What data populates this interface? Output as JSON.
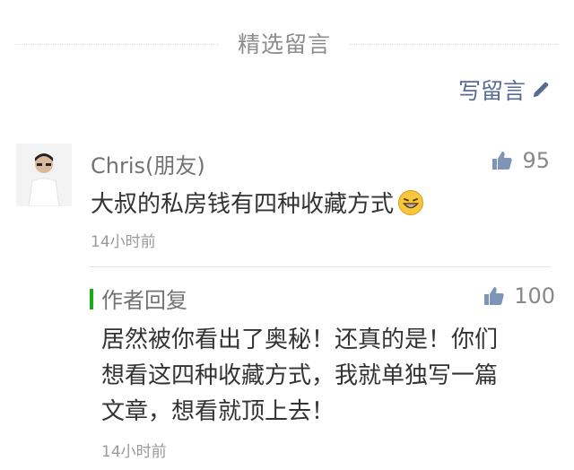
{
  "section": {
    "title": "精选留言"
  },
  "write_button": {
    "label": "写留言",
    "icon": "pencil-icon"
  },
  "comment": {
    "nickname": "Chris(朋友)",
    "likes": "95",
    "text": "大叔的私房钱有四种收藏方式",
    "emoji": "grinning-emoji",
    "time": "14小时前"
  },
  "reply": {
    "label": "作者回复",
    "likes": "100",
    "lines": [
      "居然被你看出了奥秘！还真的是！你们",
      "想看这四种收藏方式，我就单独写一篇",
      "文章，想看就顶上去！"
    ],
    "time": "14小时前"
  },
  "colors": {
    "link": "#576b95",
    "accent": "#1aad19",
    "muted": "#9a9a9a"
  }
}
